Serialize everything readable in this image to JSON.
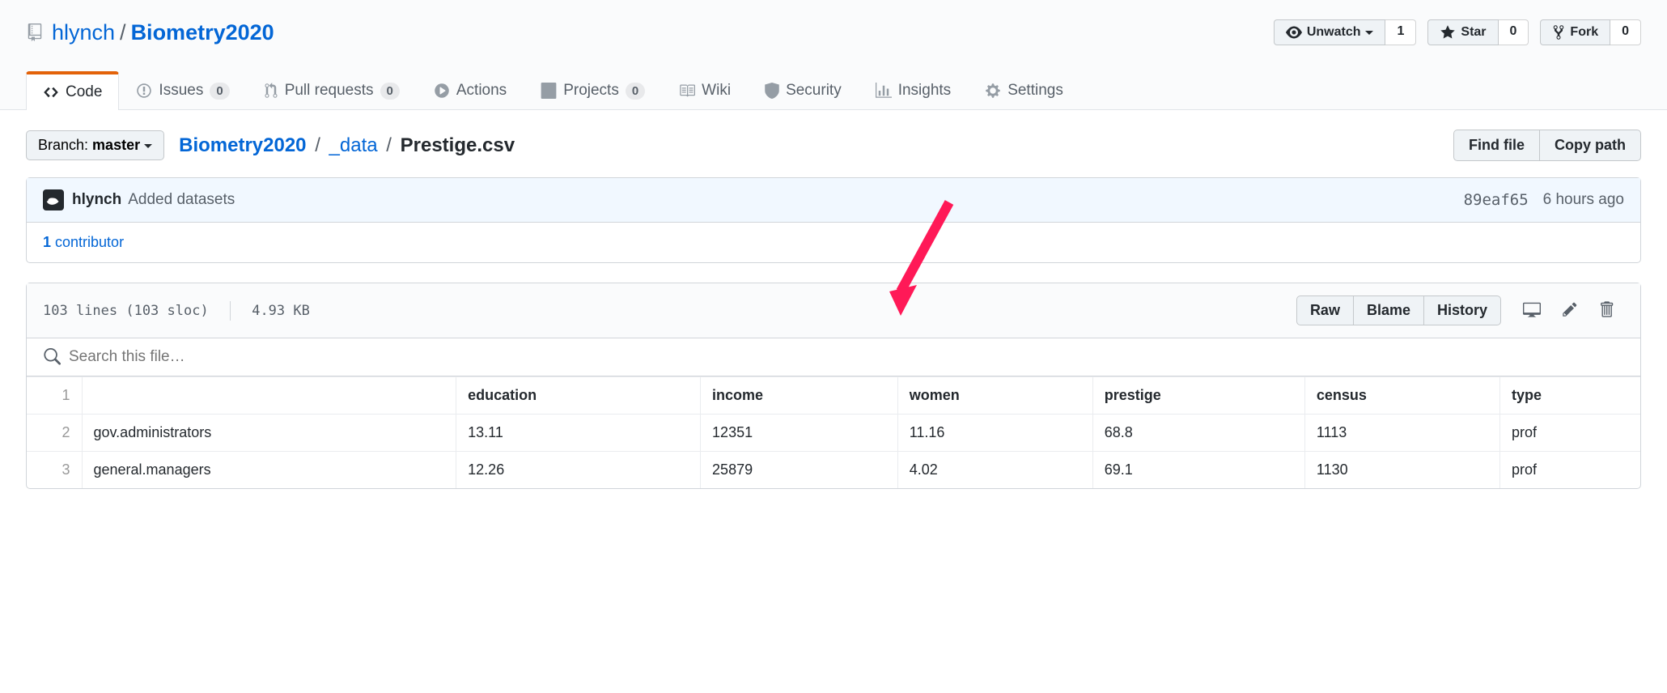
{
  "repo": {
    "owner": "hlynch",
    "name": "Biometry2020",
    "sep": "/"
  },
  "actions": {
    "watch": {
      "label": "Unwatch",
      "count": "1"
    },
    "star": {
      "label": "Star",
      "count": "0"
    },
    "fork": {
      "label": "Fork",
      "count": "0"
    }
  },
  "tabs": {
    "code": "Code",
    "issues": "Issues",
    "issues_count": "0",
    "pulls": "Pull requests",
    "pulls_count": "0",
    "actions": "Actions",
    "projects": "Projects",
    "projects_count": "0",
    "wiki": "Wiki",
    "security": "Security",
    "insights": "Insights",
    "settings": "Settings"
  },
  "branch": {
    "prefix": "Branch: ",
    "name": "master"
  },
  "crumbs": {
    "root": "Biometry2020",
    "dir": "_data",
    "file": "Prestige.csv",
    "sep": "/"
  },
  "navbtns": {
    "find": "Find file",
    "copy": "Copy path"
  },
  "commit": {
    "author": "hlynch",
    "message": "Added datasets",
    "sha": "89eaf65",
    "time": "6 hours ago"
  },
  "contributors": {
    "count": "1",
    "label": " contributor"
  },
  "fileinfo": {
    "lines": "103 lines (103 sloc)",
    "size": "4.93 KB"
  },
  "filebtns": {
    "raw": "Raw",
    "blame": "Blame",
    "history": "History"
  },
  "search": {
    "placeholder": "Search this file…"
  },
  "table": {
    "header_ln": "1",
    "headers": [
      "",
      "education",
      "income",
      "women",
      "prestige",
      "census",
      "type"
    ],
    "rows": [
      {
        "ln": "2",
        "cells": [
          "gov.administrators",
          "13.11",
          "12351",
          "11.16",
          "68.8",
          "1113",
          "prof"
        ]
      },
      {
        "ln": "3",
        "cells": [
          "general.managers",
          "12.26",
          "25879",
          "4.02",
          "69.1",
          "1130",
          "prof"
        ]
      }
    ]
  }
}
